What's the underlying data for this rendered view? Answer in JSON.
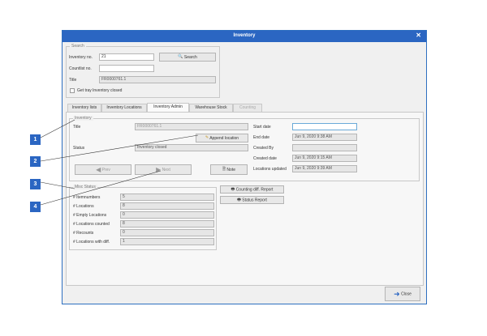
{
  "window": {
    "title": "Inventory"
  },
  "search": {
    "group_label": "Search",
    "inventory_no_label": "Inventory no.",
    "inventory_no_value": "21",
    "search_button": "Search",
    "countlist_no_label": "Countlist no.",
    "countlist_no_value": "",
    "title_label": "Title",
    "title_value": "FR0000761.1",
    "get_tray_label": "Get tray",
    "inventory_closed_label": "Inventory closed"
  },
  "tabs": [
    {
      "label": "Inventory lists"
    },
    {
      "label": "Inventory Locations"
    },
    {
      "label": "Inventory Admin"
    },
    {
      "label": "Warehouse Stock"
    },
    {
      "label": "Counting"
    }
  ],
  "inventory": {
    "group_label": "Inventory",
    "title_label": "Title",
    "title_value": "FR0000761.1",
    "append_location_button": "Append location",
    "status_label": "Status",
    "status_value": "Inventory closed",
    "prev_button": "Prev",
    "next_button": "Next",
    "note_button": "Note",
    "start_date_label": "Start date",
    "start_date_value": "",
    "end_date_label": "End date",
    "end_date_value": "Jun 9, 2020 9:38 AM",
    "created_by_label": "Created By",
    "created_by_value": "",
    "created_date_label": "Created date",
    "created_date_value": "Jun 9, 2020 9:15 AM",
    "locations_updated_label": "Locations updated",
    "locations_updated_value": "Jun 9, 2020 9:39 AM"
  },
  "misc_status": {
    "group_label": "Misc Status",
    "rows": [
      {
        "label": "# Itemnumbers",
        "value": "5"
      },
      {
        "label": "# Locations",
        "value": "8"
      },
      {
        "label": "# Empty Locations",
        "value": "0"
      },
      {
        "label": "# Locations counted",
        "value": "8"
      },
      {
        "label": "# Recounts",
        "value": "0"
      },
      {
        "label": "# Locations with diff.",
        "value": "1"
      }
    ]
  },
  "reports": {
    "counting_diff_report": "Counting diff. Report",
    "status_report": "Status Report"
  },
  "footer": {
    "close_button": "Close"
  },
  "markers": [
    "1",
    "2",
    "3",
    "4"
  ],
  "colors": {
    "titlebar": "#2b66c2",
    "marker": "#2b66c2",
    "window_bg": "#f0f0f0"
  }
}
